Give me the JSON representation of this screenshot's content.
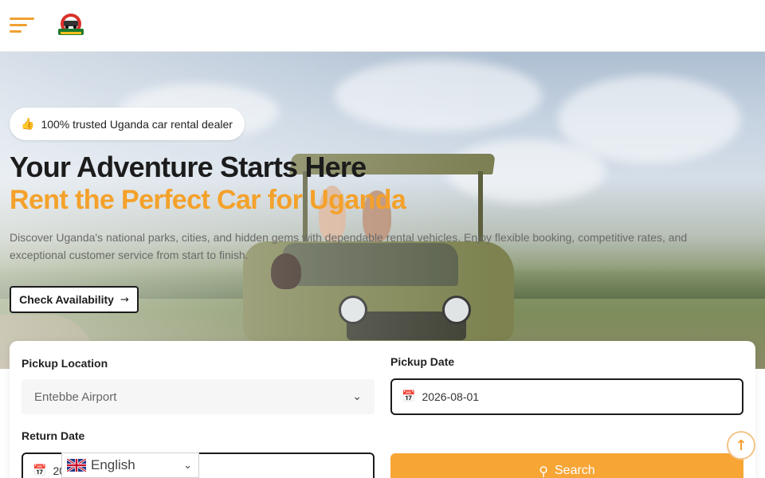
{
  "header": {
    "menu_icon": "hamburger-menu-icon",
    "logo_name": "uganda-car-rental-logo",
    "logo_text": "UGANDA",
    "accent": "#f0a032"
  },
  "hero": {
    "badge_icon": "thumbs-up-icon",
    "badge_text": "100% trusted Uganda car rental dealer",
    "title_line1": "Your Adventure Starts Here",
    "title_line2": "Rent the Perfect Car for Uganda",
    "description": "Discover Uganda's national parks, cities, and hidden gems with dependable rental vehicles. Enjoy flexible booking, competitive rates, and exceptional customer service from start to finish.",
    "cta_label": "Check Availability",
    "cta_icon": "arrow-right-icon",
    "title_color": "#1c1c1c",
    "highlight_color": "#f4a12a"
  },
  "booking": {
    "pickup_location_label": "Pickup Location",
    "pickup_location_value": "Entebbe Airport",
    "pickup_date_label": "Pickup Date",
    "pickup_date_value": "2026-08-01",
    "return_date_label": "Return Date",
    "return_date_value": "2026-08-05",
    "search_label": "Search",
    "search_color": "#f7a535"
  },
  "language": {
    "selected": "English",
    "flag_icon": "uk-flag-icon"
  },
  "scroll_top_icon": "arrow-up-icon"
}
